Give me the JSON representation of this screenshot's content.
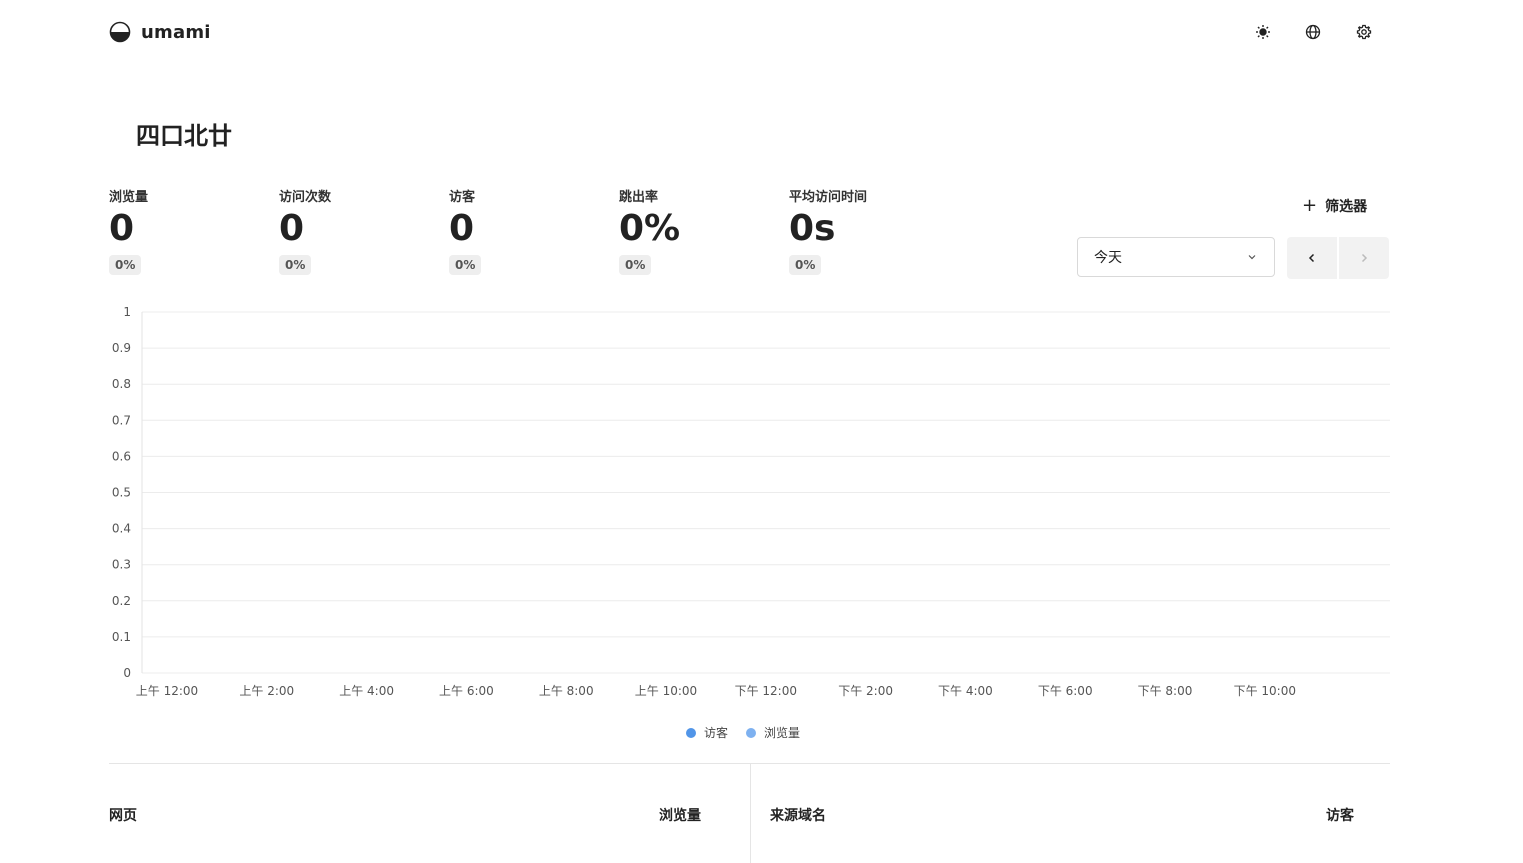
{
  "header": {
    "brand": "umami",
    "icons": [
      "sun-icon",
      "globe-icon",
      "gear-icon"
    ]
  },
  "page": {
    "title": "四口北廿"
  },
  "metrics": [
    {
      "label": "浏览量",
      "value": "0",
      "change": "0%"
    },
    {
      "label": "访问次数",
      "value": "0",
      "change": "0%"
    },
    {
      "label": "访客",
      "value": "0",
      "change": "0%"
    },
    {
      "label": "跳出率",
      "value": "0%",
      "change": "0%"
    },
    {
      "label": "平均访问时间",
      "value": "0s",
      "change": "0%"
    }
  ],
  "controls": {
    "filter_label": "筛选器",
    "date_range": "今天"
  },
  "chart_data": {
    "type": "bar",
    "categories": [
      "上午 12:00",
      "上午 2:00",
      "上午 4:00",
      "上午 6:00",
      "上午 8:00",
      "上午 10:00",
      "下午 12:00",
      "下午 2:00",
      "下午 4:00",
      "下午 6:00",
      "下午 8:00",
      "下午 10:00"
    ],
    "series": [
      {
        "name": "访客",
        "values": [
          0,
          0,
          0,
          0,
          0,
          0,
          0,
          0,
          0,
          0,
          0,
          0
        ],
        "color": "#5195e8"
      },
      {
        "name": "浏览量",
        "values": [
          0,
          0,
          0,
          0,
          0,
          0,
          0,
          0,
          0,
          0,
          0,
          0
        ],
        "color": "#7eb1f0"
      }
    ],
    "yticks": [
      "0",
      "0.1",
      "0.2",
      "0.3",
      "0.4",
      "0.5",
      "0.6",
      "0.7",
      "0.8",
      "0.9",
      "1"
    ],
    "ylim": [
      0,
      1
    ],
    "grid": true,
    "legend": "bottom"
  },
  "tables": [
    {
      "title": "网页",
      "metric": "浏览量"
    },
    {
      "title": "来源域名",
      "metric": "访客"
    }
  ]
}
